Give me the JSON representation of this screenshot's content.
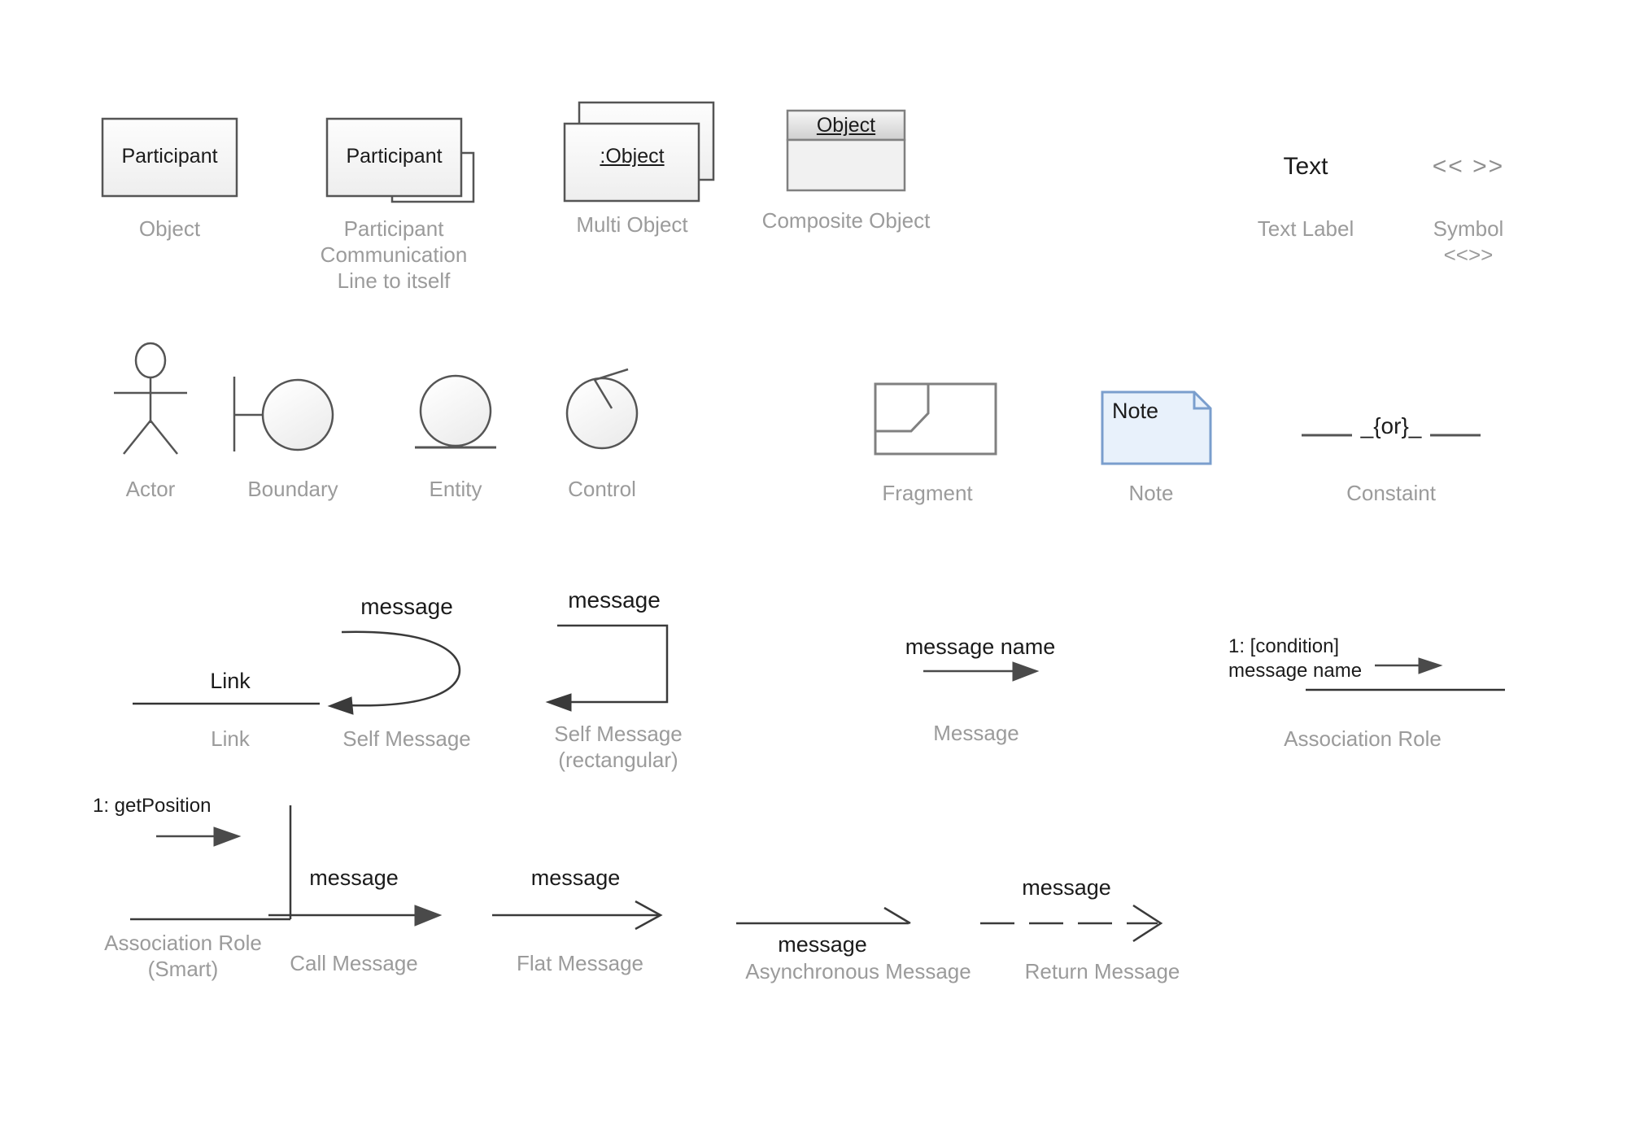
{
  "page": {
    "title": "UML Sequence Diagram Shapes Library",
    "background_color": "#ffffff",
    "caption_color": "#9b9b9b",
    "stroke_color": "#555555",
    "text_color": "#23201e",
    "note_fill": "#e8f1fb",
    "note_stroke": "#7a9ecd"
  },
  "shapes": [
    {
      "id": "object",
      "caption": "Object",
      "inner_text": "Participant",
      "icon": "rectangle-gradient"
    },
    {
      "id": "participant-communication-line-to-itself",
      "caption": "Participant Communication\nLine to itself",
      "inner_text": "Participant",
      "icon": "rectangle-with-self-loop"
    },
    {
      "id": "multi-object",
      "caption": "Multi Object",
      "inner_text": ":Object",
      "icon": "stacked-rectangles"
    },
    {
      "id": "composite-object",
      "caption": "Composite Object",
      "inner_text": "Object",
      "icon": "header-body-rectangle"
    },
    {
      "id": "text-label",
      "caption": "Text Label",
      "inner_text": "Text",
      "icon": "plain-text"
    },
    {
      "id": "symbol",
      "caption": "Symbol\n<<>>",
      "inner_text": "<< >>",
      "icon": "guillemet-symbol"
    },
    {
      "id": "actor",
      "caption": "Actor",
      "inner_text": "",
      "icon": "stick-figure"
    },
    {
      "id": "boundary",
      "caption": "Boundary",
      "inner_text": "",
      "icon": "boundary-circle-bar"
    },
    {
      "id": "entity",
      "caption": "Entity",
      "inner_text": "",
      "icon": "entity-circle-underline"
    },
    {
      "id": "control",
      "caption": "Control",
      "inner_text": "",
      "icon": "control-circle-arrow"
    },
    {
      "id": "fragment",
      "caption": "Fragment",
      "inner_text": "",
      "icon": "fragment-pentagon-box"
    },
    {
      "id": "note",
      "caption": "Note",
      "inner_text": "Note",
      "icon": "note-folded-corner"
    },
    {
      "id": "constaint",
      "caption": "Constaint",
      "inner_text": "_{or}_",
      "icon": "constraint-or"
    },
    {
      "id": "link",
      "caption": "Link",
      "inner_text": "Link",
      "icon": "plain-line"
    },
    {
      "id": "self-message",
      "caption": "Self Message",
      "inner_text": "message",
      "icon": "curved-self-arrow"
    },
    {
      "id": "self-message-rectangular",
      "caption": "Self Message\n(rectangular)",
      "inner_text": "message",
      "icon": "rectangular-self-arrow"
    },
    {
      "id": "message",
      "caption": "Message",
      "inner_text": "message name",
      "icon": "solid-arrow"
    },
    {
      "id": "association-role",
      "caption": "Association Role",
      "inner_text": "1: [condition]\nmessage name",
      "icon": "association-role-arrow"
    },
    {
      "id": "association-role-smart",
      "caption": "Association Role\n(Smart)",
      "inner_text": "1: getPosition",
      "icon": "elbow-line-arrow"
    },
    {
      "id": "call-message",
      "caption": "Call Message",
      "inner_text": "message",
      "icon": "solid-filled-arrow"
    },
    {
      "id": "flat-message",
      "caption": "Flat Message",
      "inner_text": "message",
      "icon": "open-arrow"
    },
    {
      "id": "asynchronous-message",
      "caption": "Asynchronous Message",
      "inner_text": "message",
      "icon": "half-open-arrow"
    },
    {
      "id": "return-message",
      "caption": "Return Message",
      "inner_text": "message",
      "icon": "dashed-open-arrow"
    }
  ]
}
